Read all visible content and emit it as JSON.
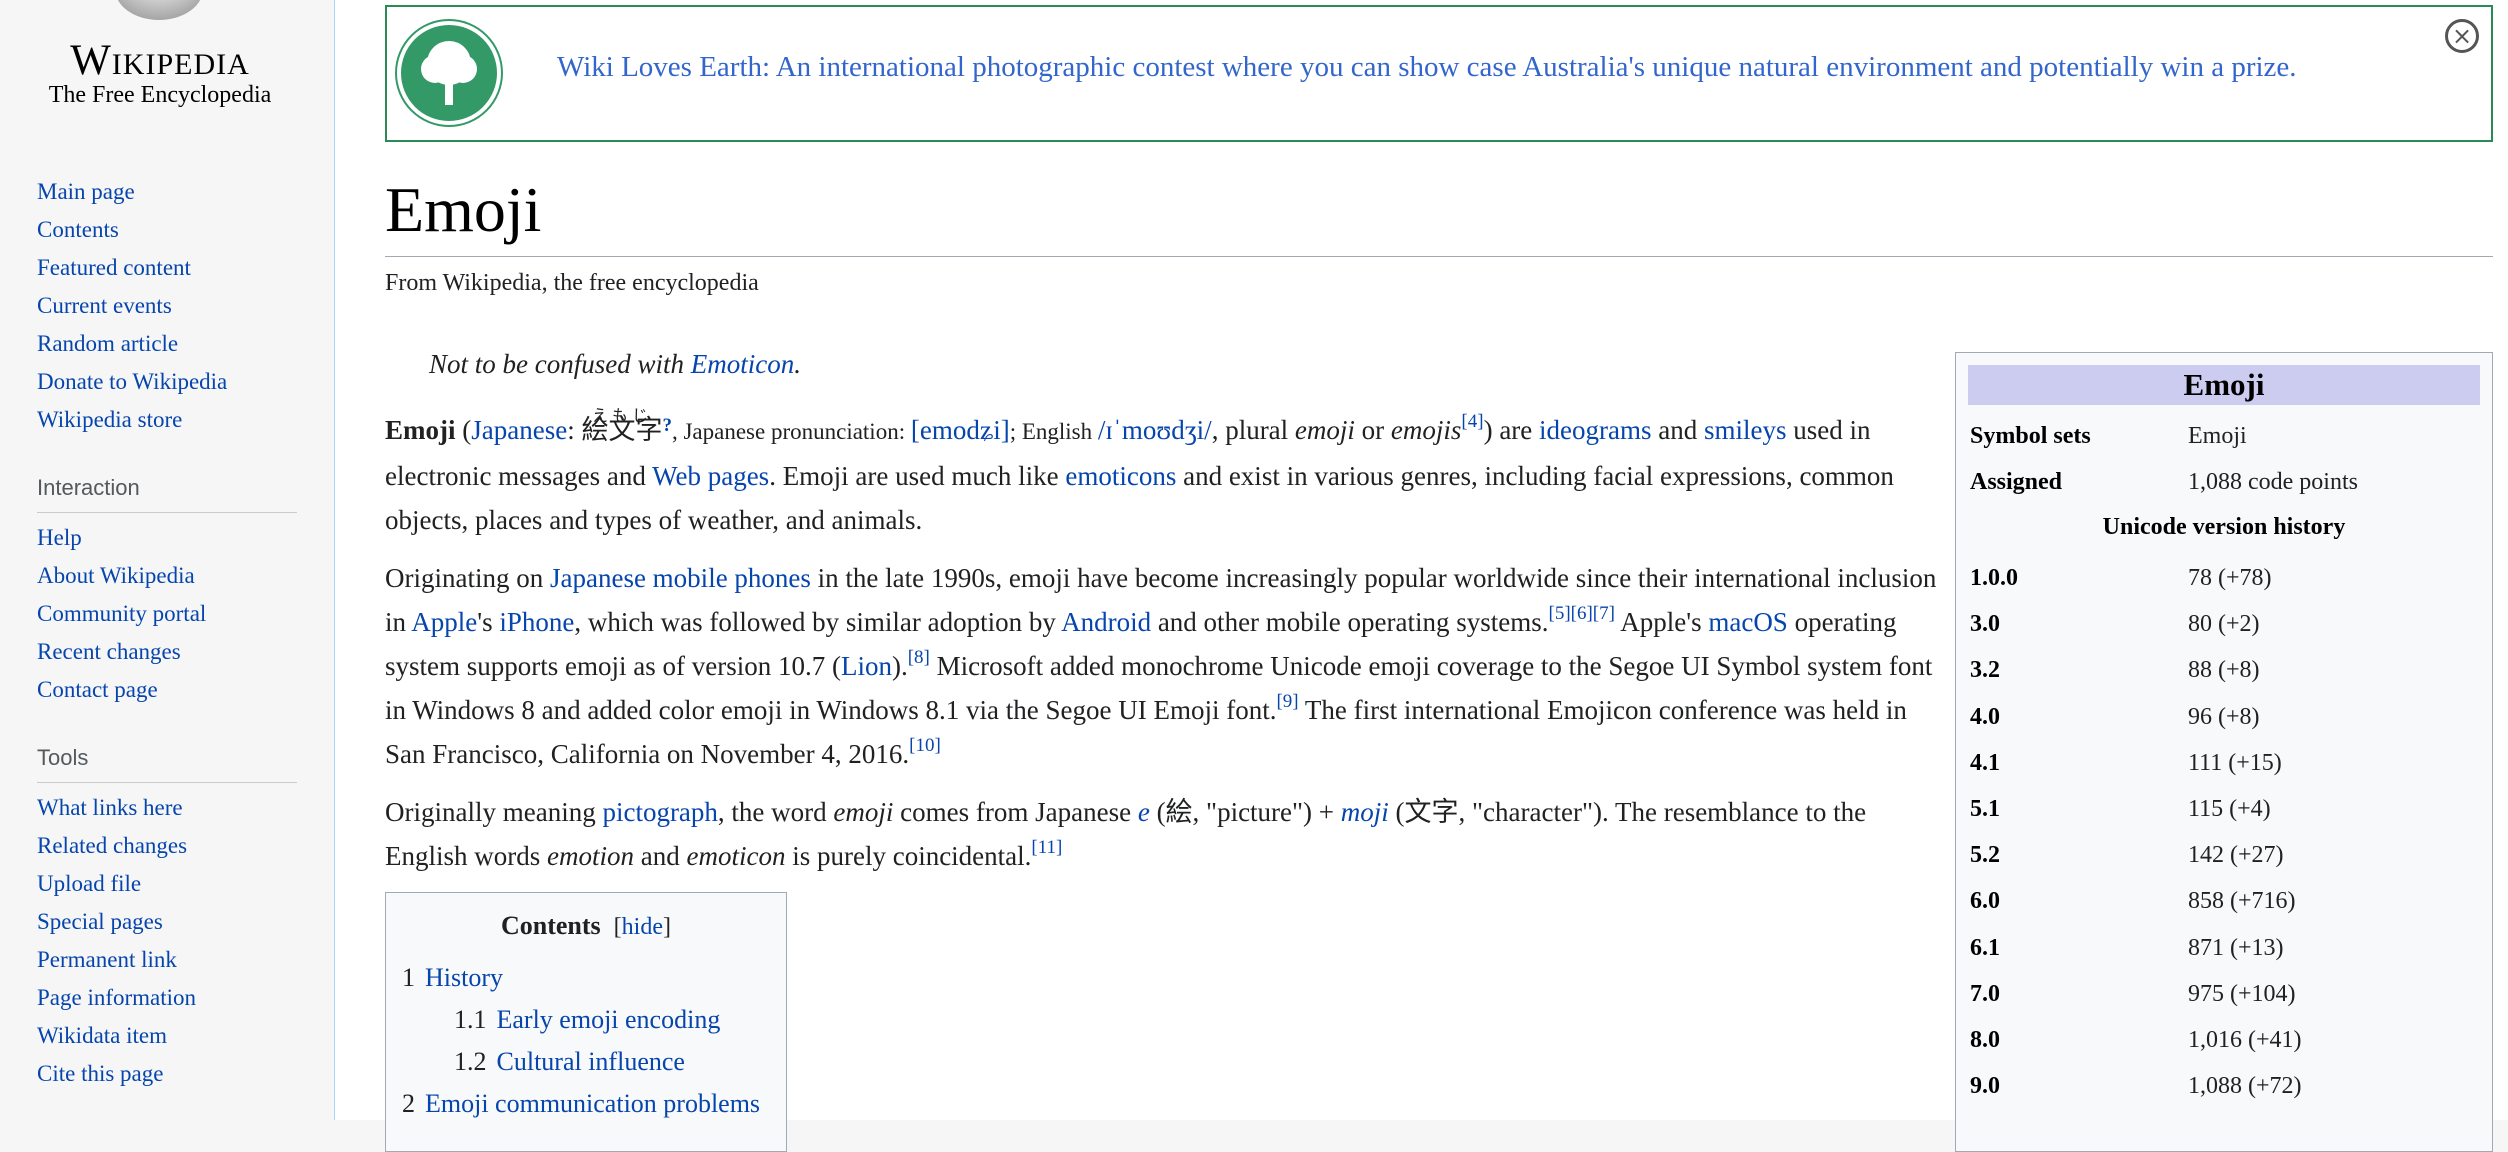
{
  "branding": {
    "wordmark": "Wikipedia",
    "tagline": "The Free Encyclopedia"
  },
  "sidebar": {
    "main": [
      {
        "label": "Main page"
      },
      {
        "label": "Contents"
      },
      {
        "label": "Featured content"
      },
      {
        "label": "Current events"
      },
      {
        "label": "Random article"
      },
      {
        "label": "Donate to Wikipedia"
      },
      {
        "label": "Wikipedia store"
      }
    ],
    "interaction": {
      "heading": "Interaction",
      "items": [
        {
          "label": "Help"
        },
        {
          "label": "About Wikipedia"
        },
        {
          "label": "Community portal"
        },
        {
          "label": "Recent changes"
        },
        {
          "label": "Contact page"
        }
      ]
    },
    "tools": {
      "heading": "Tools",
      "items": [
        {
          "label": "What links here"
        },
        {
          "label": "Related changes"
        },
        {
          "label": "Upload file"
        },
        {
          "label": "Special pages"
        },
        {
          "label": "Permanent link"
        },
        {
          "label": "Page information"
        },
        {
          "label": "Wikidata item"
        },
        {
          "label": "Cite this page"
        }
      ]
    }
  },
  "banner": {
    "text": "Wiki Loves Earth: An international photographic contest where you can show case Australia's unique natural environment and potentially win a prize.",
    "close_symbol": "×"
  },
  "article": {
    "title": "Emoji",
    "from_line": "From Wikipedia, the free encyclopedia",
    "hatnote": {
      "prefix": "Not to be confused with ",
      "link": "Emoticon",
      "suffix": "."
    },
    "p1": {
      "term": "Emoji",
      "open": " (",
      "lang_link": "Japanese",
      "colon": ": ",
      "kanji": "絵文字",
      "kana": "えもじ",
      "q": "?",
      "jp_pron_label": ", Japanese pronunciation: ",
      "jp_ipa": "[emodʑi]",
      "eng_label": "; English ",
      "eng_ipa": "/ɪˈmoʊdʒi/",
      "plural": ", plural ",
      "emoji_it": "emoji",
      "or": " or ",
      "emojis_it": "emojis",
      "ref4": "[4]",
      "are": ") are ",
      "ideograms": "ideograms",
      "and": " and ",
      "smileys": "smileys",
      "used_in": " used in electronic messages and ",
      "web_pages": "Web pages",
      "rest1": ". Emoji are used much like ",
      "emoticons": "emoticons",
      "rest2": " and exist in various genres, including facial expressions, common objects, places and types of weather, and animals."
    },
    "p2": {
      "t1": "Originating on ",
      "l1": "Japanese mobile phones",
      "t2": " in the late 1990s, emoji have become increasingly popular worldwide since their international inclusion in ",
      "l2": "Apple",
      "t3": "'s ",
      "l3": "iPhone",
      "t4": ", which was followed by similar adoption by ",
      "l4": "Android",
      "t5": " and other mobile operating systems.",
      "r567": "[5][6][7]",
      "t6": " Apple's ",
      "l5": "macOS",
      "t7": " operating system supports emoji as of version 10.7 (",
      "l6": "Lion",
      "t8": ").",
      "r8": "[8]",
      "t9": " Microsoft added monochrome Unicode emoji coverage to the Segoe UI Symbol system font in Windows 8 and added color emoji in Windows 8.1 via the Segoe UI Emoji font.",
      "r9": "[9]",
      "t10": " The first international Emojicon conference was held in San Francisco, California on November 4, 2016.",
      "r10": "[10]"
    },
    "p3": {
      "t1": "Originally meaning ",
      "l1": "pictograph",
      "t2": ", the word ",
      "emoji_it": "emoji",
      "t3": " comes from Japanese ",
      "e": "e",
      "t4": " (絵, \"picture\") + ",
      "moji": "moji",
      "t5": " (文字, \"character\"). The resemblance to the English words ",
      "emotion": "emotion",
      "t6": " and ",
      "emoticon": "emoticon",
      "t7": " is purely coincidental.",
      "r11": "[11]"
    }
  },
  "toc": {
    "title": "Contents",
    "hide_label": "hide",
    "open_bracket": "[",
    "close_bracket": "]",
    "items": [
      {
        "num": "1",
        "label": "History"
      },
      {
        "num": "1.1",
        "label": "Early emoji encoding"
      },
      {
        "num": "1.2",
        "label": "Cultural influence"
      },
      {
        "num": "2",
        "label": "Emoji communication problems"
      }
    ]
  },
  "infobox": {
    "title": "Emoji",
    "rows": [
      {
        "key": "Symbol sets",
        "value": "Emoji"
      },
      {
        "key": "Assigned",
        "value": "1,088 code points"
      }
    ],
    "history_heading": "Unicode version history",
    "history": [
      {
        "version": "1.0.0",
        "value": "78 (+78)"
      },
      {
        "version": "3.0",
        "value": "80 (+2)"
      },
      {
        "version": "3.2",
        "value": "88 (+8)"
      },
      {
        "version": "4.0",
        "value": "96 (+8)"
      },
      {
        "version": "4.1",
        "value": "111 (+15)"
      },
      {
        "version": "5.1",
        "value": "115 (+4)"
      },
      {
        "version": "5.2",
        "value": "142 (+27)"
      },
      {
        "version": "6.0",
        "value": "858 (+716)"
      },
      {
        "version": "6.1",
        "value": "871 (+13)"
      },
      {
        "version": "7.0",
        "value": "975 (+104)"
      },
      {
        "version": "8.0",
        "value": "1,016 (+41)"
      },
      {
        "version": "9.0",
        "value": "1,088 (+72)"
      }
    ]
  },
  "colors": {
    "link": "#0645ad",
    "banner_border": "#2a8b57",
    "banner_text": "#3366cc",
    "infobox_header": "#ccccf0"
  }
}
